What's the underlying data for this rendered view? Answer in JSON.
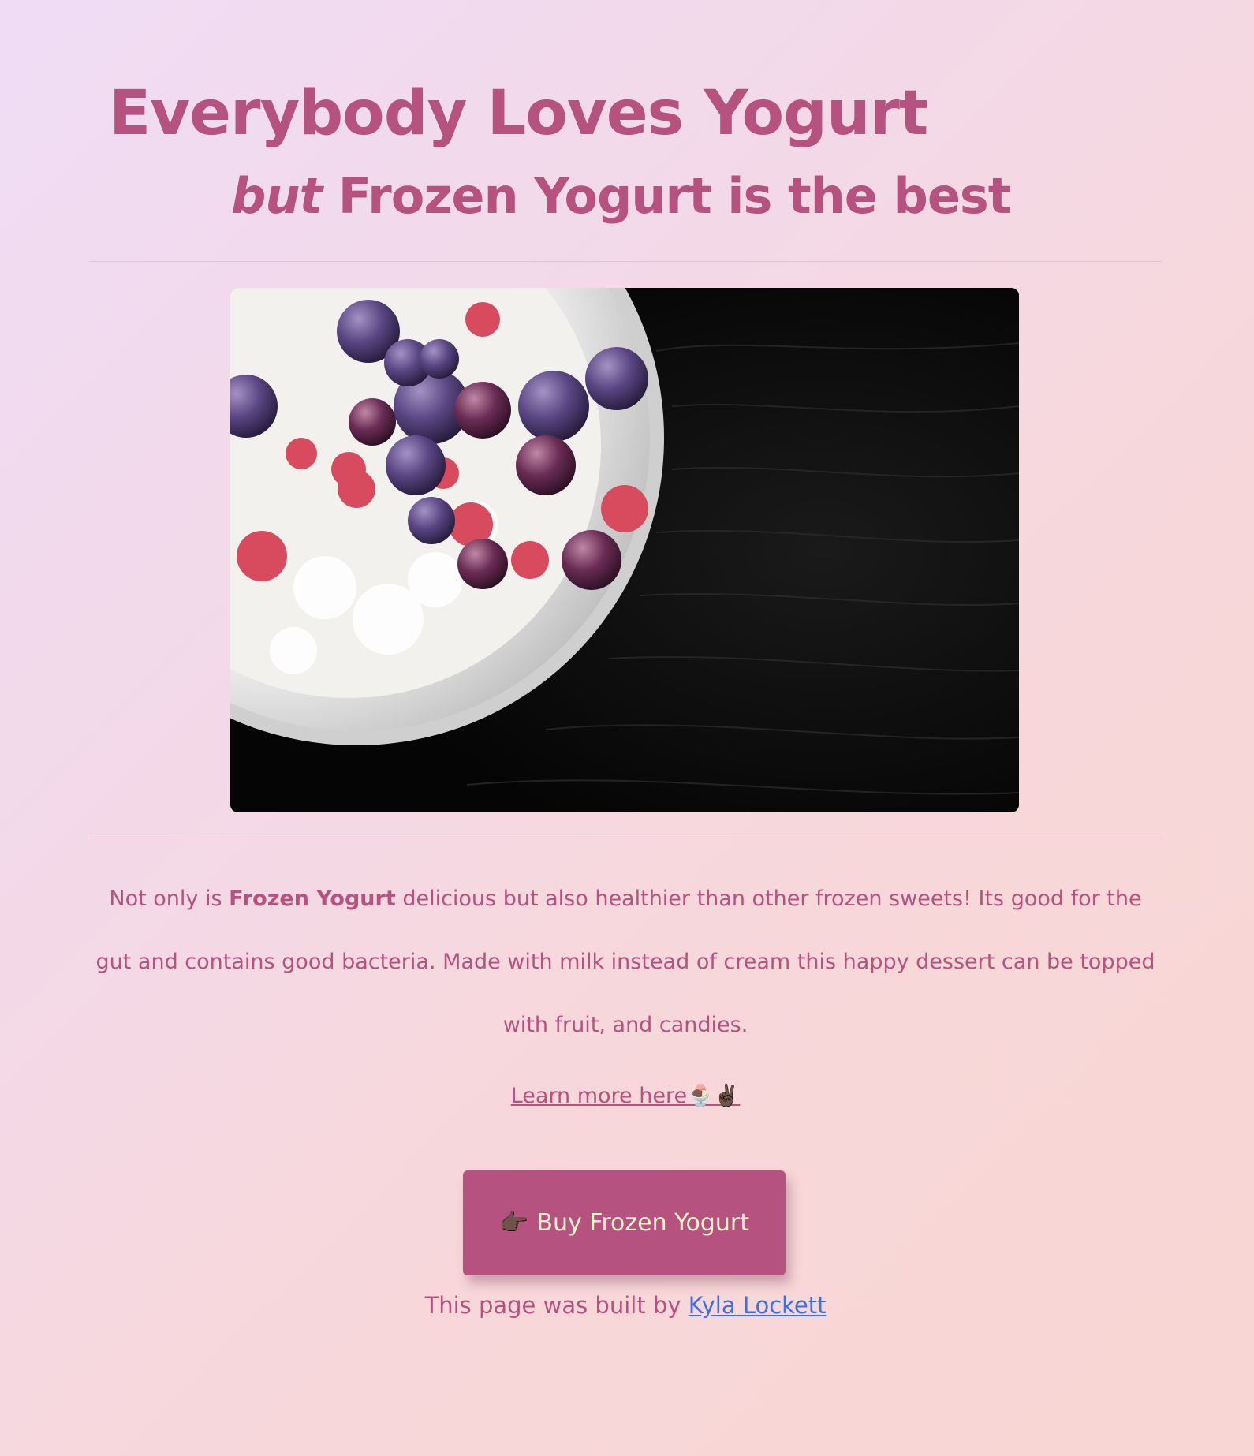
{
  "header": {
    "title": "Everybody Loves Yogurt",
    "subtitle_em": "but",
    "subtitle_rest": " Frozen Yogurt is the best"
  },
  "hero_image": {
    "subject": "bowl of frozen yogurt with frozen blueberries and raspberries on a dark wood table"
  },
  "description": {
    "before_bold": "Not only is ",
    "bold": "Frozen Yogurt",
    "after_bold": " delicious but also healthier than other frozen sweets! Its good for the gut and contains good bacteria. Made with milk instead of cream this happy dessert can be topped with fruit, and candies."
  },
  "learn_more": {
    "label": "Learn more here🍨✌🏿"
  },
  "buy_button": {
    "icon": "👉🏿",
    "label": "Buy Frozen Yogurt"
  },
  "footer": {
    "credit_text": "This page was built by ",
    "author": "Kyla Lockett"
  },
  "colors": {
    "accent": "#b5527f",
    "button_text": "#fff3c7",
    "link": "#3a6fe8"
  }
}
